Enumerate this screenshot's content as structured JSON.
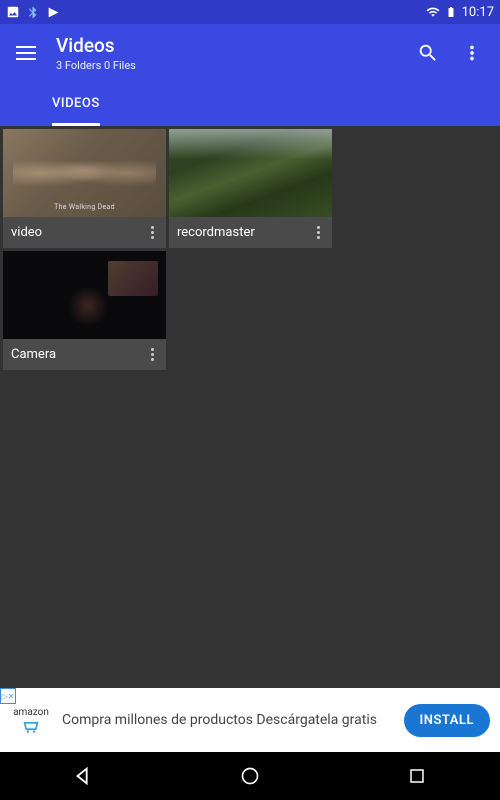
{
  "status_bar": {
    "time": "10:17"
  },
  "app_bar": {
    "title": "Videos",
    "subtitle": "3 Folders 0 Files"
  },
  "tabs": [
    {
      "label": "VIDEOS"
    }
  ],
  "folders": [
    {
      "name": "video"
    },
    {
      "name": "recordmaster"
    },
    {
      "name": "Camera"
    }
  ],
  "ad": {
    "brand": "amazon",
    "text": "Compra millones de productos Descárgatela gratis",
    "cta": "INSTALL",
    "badge": "▷✕"
  }
}
